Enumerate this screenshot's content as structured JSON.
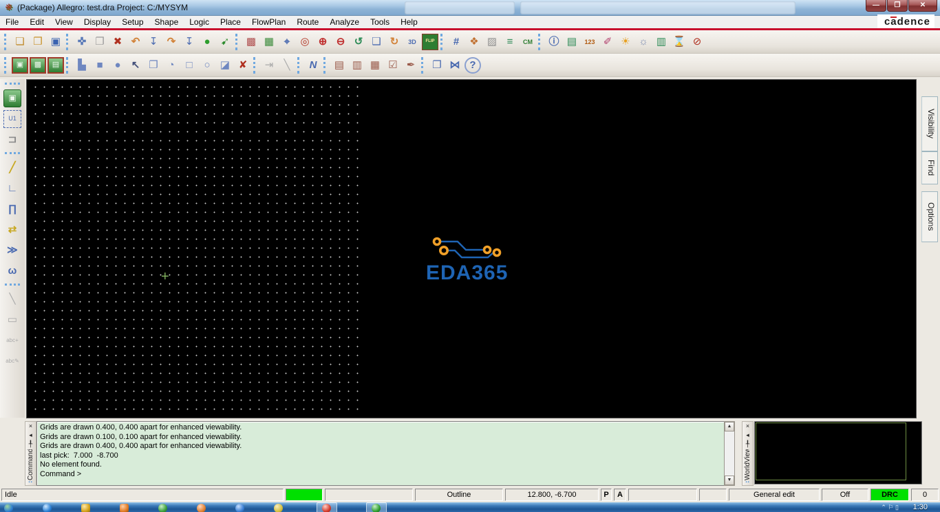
{
  "window": {
    "title": "(Package) Allegro: test.dra  Project: C:/MYSYM",
    "app_icon_glyph": "❋",
    "controls": {
      "minimize": "—",
      "restore": "❐",
      "close": "✕"
    }
  },
  "menu": {
    "items": [
      {
        "label": "File"
      },
      {
        "label": "Edit"
      },
      {
        "label": "View"
      },
      {
        "label": "Display"
      },
      {
        "label": "Setup"
      },
      {
        "label": "Shape"
      },
      {
        "label": "Logic"
      },
      {
        "label": "Place"
      },
      {
        "label": "FlowPlan"
      },
      {
        "label": "Route"
      },
      {
        "label": "Analyze"
      },
      {
        "label": "Tools"
      },
      {
        "label": "Help"
      }
    ],
    "brand": "cadence",
    "brand_accent_color": "#cc2027"
  },
  "toolbar_row1": [
    {
      "name": "new-file",
      "glyph": "❏",
      "css": "color:#c08a2a"
    },
    {
      "name": "open-folder",
      "glyph": "❒",
      "css": "color:#c8922a"
    },
    {
      "name": "save",
      "glyph": "▣",
      "css": "color:#3a62b0"
    },
    {
      "name": "move",
      "glyph": "✜",
      "css": "color:#5a7ab8;font-weight:bold"
    },
    {
      "name": "copy",
      "glyph": "❐",
      "css": "color:#9a9a9a"
    },
    {
      "name": "delete",
      "glyph": "✖",
      "css": "color:#b03020"
    },
    {
      "name": "undo",
      "glyph": "↶",
      "css": "color:#d2833a;font-weight:bold"
    },
    {
      "name": "pick-down",
      "glyph": "↧",
      "css": "color:#4a6ab0"
    },
    {
      "name": "redo",
      "glyph": "↷",
      "css": "color:#d2833a;font-weight:bold"
    },
    {
      "name": "drop-down",
      "glyph": "↧",
      "css": "color:#4a6ab0"
    },
    {
      "name": "highlight-ball",
      "glyph": "●",
      "css": "color:#2e9e2e"
    },
    {
      "name": "pin",
      "glyph": "➹",
      "css": "color:#2e8b2e"
    },
    {
      "name": "rats-off",
      "glyph": "▩",
      "css": "color:#b05050"
    },
    {
      "name": "rats-on",
      "glyph": "▦",
      "css": "color:#3a8a3a"
    },
    {
      "name": "zoom-points",
      "glyph": "⌖",
      "css": "color:#4a6ab0;font-weight:bold"
    },
    {
      "name": "zoom-fit",
      "glyph": "◎",
      "css": "color:#b03020"
    },
    {
      "name": "zoom-in",
      "glyph": "⊕",
      "css": "color:#c03030;font-weight:bold"
    },
    {
      "name": "zoom-out",
      "glyph": "⊖",
      "css": "color:#c03030;font-weight:bold"
    },
    {
      "name": "zoom-previous",
      "glyph": "↺",
      "css": "color:#2e8b57;font-weight:bold"
    },
    {
      "name": "zoom-selection",
      "glyph": "❑",
      "css": "color:#4a6ab0"
    },
    {
      "name": "redraw",
      "glyph": "↻",
      "css": "color:#d2833a;font-weight:bold"
    },
    {
      "name": "view-3d",
      "glyph": "3D",
      "css": "color:#4a6ab0"
    },
    {
      "name": "flip-design",
      "glyph": "FLIP",
      "css": "color:#ffe9a0;background:#2e7d32;border:1px solid #8a3a2a;font-size:6px;line-height:20px"
    },
    {
      "name": "grid-toggle",
      "glyph": "#",
      "css": "color:#4a6ab0;font-weight:bold"
    },
    {
      "name": "color-palette",
      "glyph": "❖",
      "css": "color:#c07030"
    },
    {
      "name": "shadow-mode",
      "glyph": "▨",
      "css": "color:#909090"
    },
    {
      "name": "layer-stack",
      "glyph": "≡",
      "css": "color:#2e8b57;font-weight:bold"
    },
    {
      "name": "constraint-manager",
      "glyph": "CM",
      "css": "color:#2e7d32"
    },
    {
      "name": "info",
      "glyph": "ⓘ",
      "css": "color:#4a6ab0;font-weight:bold"
    },
    {
      "name": "element-properties",
      "glyph": "▤",
      "css": "color:#2e8b57"
    },
    {
      "name": "measure",
      "glyph": "123",
      "css": "color:#b05a10"
    },
    {
      "name": "color-brush",
      "glyph": "✐",
      "css": "color:#b03a6a"
    },
    {
      "name": "highlight-sun",
      "glyph": "☀",
      "css": "color:#e8a020"
    },
    {
      "name": "custom-highlight",
      "glyph": "☼",
      "css": "color:#7a8ab0"
    },
    {
      "name": "layer-bars",
      "glyph": "▥",
      "css": "color:#2e8b57"
    },
    {
      "name": "waive-drc",
      "glyph": "⌛",
      "css": "color:#1f8a1f"
    },
    {
      "name": "fix-cursor",
      "glyph": "⊘",
      "css": "color:#b03020"
    }
  ],
  "toolbar_row2": [
    {
      "name": "board-symbol-1",
      "glyph": "▣",
      "css": "color:#e8f5e8;background:linear-gradient(#8cc88c,#2e7d32);border:2px solid #a03a2a;font-size:11px;line-height:18px"
    },
    {
      "name": "board-symbol-2",
      "glyph": "▩",
      "css": "color:#e8f5e8;background:linear-gradient(#8cc88c,#2e7d32);border:2px solid #a03a2a;font-size:11px;line-height:18px"
    },
    {
      "name": "board-symbol-3",
      "glyph": "▤",
      "css": "color:#e8f5e8;background:linear-gradient(#8cc88c,#2e7d32);border:2px solid #a03a2a;font-size:11px;line-height:18px"
    },
    {
      "name": "shape-polygon",
      "glyph": "▙",
      "css": "color:#6f87c0"
    },
    {
      "name": "shape-rect-filled",
      "glyph": "■",
      "css": "color:#6f87c0"
    },
    {
      "name": "shape-circle-filled",
      "glyph": "●",
      "css": "color:#6f87c0"
    },
    {
      "name": "select-pointer",
      "glyph": "↖",
      "css": "color:#44507a;font-weight:bold"
    },
    {
      "name": "copy-shape",
      "glyph": "❐",
      "css": "color:#6f87c0"
    },
    {
      "name": "shape-arc",
      "glyph": "◔",
      "css": "color:#6f87c0"
    },
    {
      "name": "rect-outline",
      "glyph": "□",
      "css": "color:#6f87c0;font-weight:bold"
    },
    {
      "name": "circle-outline",
      "glyph": "○",
      "css": "color:#6f87c0;font-weight:bold"
    },
    {
      "name": "shape-void",
      "glyph": "◪",
      "css": "color:#6f87c0"
    },
    {
      "name": "delete-element",
      "glyph": "✘",
      "css": "color:#b03020"
    },
    {
      "name": "snap-to-line",
      "glyph": "⇥",
      "css": "color:#aaaaaa"
    },
    {
      "name": "slanted-line",
      "glyph": "╲",
      "css": "color:#aaaaaa"
    },
    {
      "name": "add-connect",
      "glyph": "N",
      "css": "color:#4a6ab0;font-weight:bold;font-style:italic"
    },
    {
      "name": "report-notepad",
      "glyph": "▤",
      "css": "color:#9a5a4a"
    },
    {
      "name": "reference-book",
      "glyph": "▥",
      "css": "color:#9a5a4a"
    },
    {
      "name": "symbol-package",
      "glyph": "▦",
      "css": "color:#9a5a4a"
    },
    {
      "name": "check-notes",
      "glyph": "☑",
      "css": "color:#9a5a4a"
    },
    {
      "name": "sign-off-pen",
      "glyph": "✒",
      "css": "color:#9a5a4a"
    },
    {
      "name": "copy-documents",
      "glyph": "❐",
      "css": "color:#4a6ab0"
    },
    {
      "name": "flow-gate",
      "glyph": "⋈",
      "css": "color:#4a6ab0;font-weight:bold"
    },
    {
      "name": "help",
      "glyph": "?",
      "css": "color:#4a6ab0;font-weight:bold;border:2px solid #8aa0d0;border-radius:50%;line-height:19px"
    }
  ],
  "left_toolbar": [
    {
      "name": "add-pin-chip",
      "glyph": "▣",
      "css": "color:#eaf6ea;background:linear-gradient(#8cc88c,#2e7d32);border:1px solid #1b5e20;border-radius:3px;font-size:12px;line-height:22px"
    },
    {
      "name": "component-outline",
      "glyph": "U1",
      "css": "color:#4a6ab0;border:1px dashed #4a6ab0;font-size:9px;line-height:22px"
    },
    {
      "name": "connector-swap",
      "glyph": "⊐",
      "css": "color:#888888;font-weight:bold"
    },
    {
      "name": "add-connect-line",
      "glyph": "╱",
      "css": "color:#c8a820;font-weight:bold"
    },
    {
      "name": "route-corner",
      "glyph": "∟",
      "css": "color:#4a6ab0;font-weight:bold"
    },
    {
      "name": "delay-tune",
      "glyph": "∏",
      "css": "color:#4a6ab0;font-weight:bold"
    },
    {
      "name": "pin-swap",
      "glyph": "⇄",
      "css": "color:#c8a820;font-weight:bold"
    },
    {
      "name": "slide",
      "glyph": "≫",
      "css": "color:#4a6ab0;font-weight:bold"
    },
    {
      "name": "meander",
      "glyph": "ω",
      "css": "color:#4a6ab0;font-weight:bold"
    },
    {
      "name": "add-line-disabled",
      "glyph": "╲",
      "css": "color:#ababab"
    },
    {
      "name": "add-rect-disabled",
      "glyph": "▭",
      "css": "color:#ababab"
    },
    {
      "name": "add-text-disabled",
      "glyph": "abc+",
      "css": "color:#ababab;font-size:8px"
    },
    {
      "name": "edit-text-disabled",
      "glyph": "abc✎",
      "css": "color:#ababab;font-size:8px"
    }
  ],
  "side_tabs": [
    {
      "label": "Visibility"
    },
    {
      "label": "Find"
    },
    {
      "label": "Options"
    }
  ],
  "canvas": {
    "logo_text": "EDA365",
    "logo_color": "#1e64b4",
    "pad_color": "#f0a028",
    "origin_cross": "+"
  },
  "console": {
    "title": "Command",
    "close_glyph": "×",
    "collapse_glyph": "◂",
    "pin_glyph": "╀",
    "scroll_up": "▲",
    "scroll_down": "▼",
    "lines": [
      "Grids are drawn 0.400, 0.400 apart for enhanced viewability.",
      "Grids are drawn 0.100, 0.100 apart for enhanced viewability.",
      "Grids are drawn 0.400, 0.400 apart for enhanced viewability.",
      "last pick:  7.000  -8.700",
      "No element found.",
      "Command >"
    ]
  },
  "worldview": {
    "title": "WorldView",
    "close_glyph": "×",
    "collapse_glyph": "◂",
    "pin_glyph": "╀"
  },
  "status_bar": {
    "state": "Idle",
    "progress_color": "#00e000",
    "mode": "Outline",
    "coords": "12.800, -6.700",
    "p_button": "P",
    "a_button": "A",
    "edit_mode": "General edit",
    "off_label": "Off",
    "drc_label": "DRC",
    "drc_color": "#00e000",
    "drc_count": "0"
  },
  "taskbar": {
    "clock": "1:30",
    "tray_glyphs": "⌃ ⚐ ▯",
    "icons": [
      {
        "name": "start-orb",
        "css": "left:6px;background:radial-gradient(circle at 35% 30%,#9fd49f,#2f7fd1 60%,#1a4f8f)"
      },
      {
        "name": "ie-icon",
        "css": "left:62px;background:radial-gradient(circle at 35% 30%,#cfe8ff,#2a7fd4 60%,#164f92)"
      },
      {
        "name": "folder-icon",
        "css": "left:118px;background:radial-gradient(circle at 35% 30%,#ffe9a8,#d4a017 60%,#8a6a10);border-radius:3px"
      },
      {
        "name": "media-icon",
        "css": "left:174px;background:radial-gradient(circle at 35% 30%,#ffd0a8,#e07820 60%,#8a4a10);border-radius:3px"
      },
      {
        "name": "green-app-icon",
        "css": "left:230px;background:radial-gradient(circle at 35% 30%,#c8f0c8,#3a9e3a 60%,#1f5f1f)"
      },
      {
        "name": "orange-app-icon",
        "css": "left:286px;background:radial-gradient(circle at 35% 30%,#ffd8c0,#e08030 60%,#8a4a18)"
      },
      {
        "name": "blue-app-icon",
        "css": "left:342px;background:radial-gradient(circle at 35% 30%,#c8e0ff,#3a7fd4 60%,#1a4a8f)"
      },
      {
        "name": "tool-icon",
        "css": "left:398px;background:radial-gradient(circle at 35% 30%,#f8ecc0,#d4c040 60%,#8a7a20)"
      },
      {
        "name": "chrome-icon",
        "css": "left:468px;background:radial-gradient(circle at 35% 30%,#ffd0c8,#d43a2a 60%,#8a2015)"
      },
      {
        "name": "allegro-icon",
        "css": "left:540px;background:radial-gradient(circle at 35% 30%,#c8f0c8,#2e9e2e 60%,#145214)"
      }
    ]
  }
}
